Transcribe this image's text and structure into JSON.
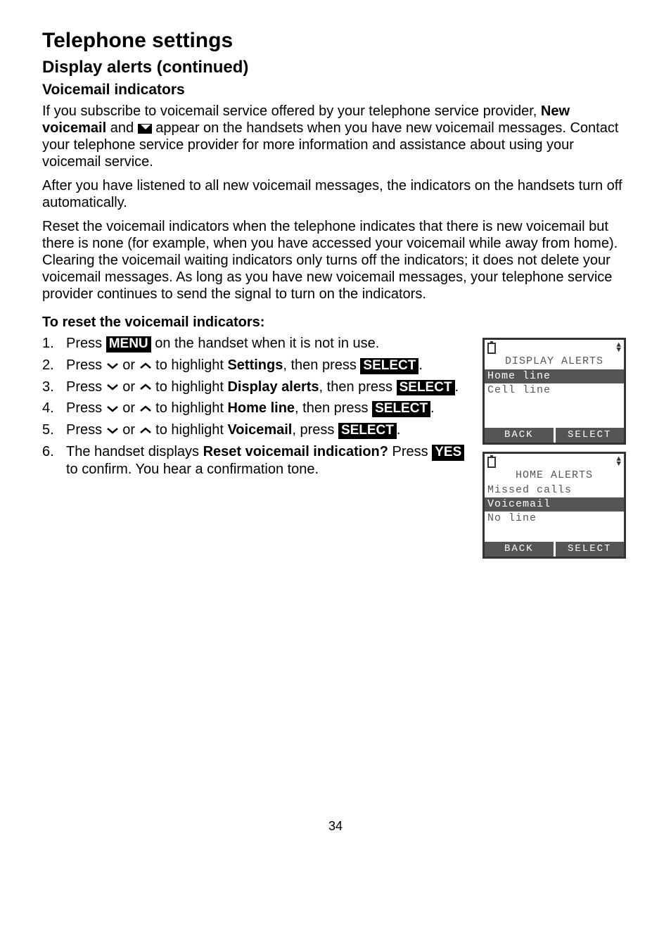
{
  "headings": {
    "h1": "Telephone settings",
    "h2": "Display alerts (continued)",
    "h3": "Voicemail indicators",
    "h4": "To reset the voicemail indicators:"
  },
  "paragraphs": {
    "p1a": "If you subscribe to voicemail service offered by your telephone service provider, ",
    "p1b": "New voicemail",
    "p1c": " and ",
    "p1d": " appear on the handsets when you have new voicemail messages. Contact your telephone service provider for more information and assistance about using your voicemail service.",
    "p2": "After you have listened to all new voicemail messages, the indicators on the handsets turn off automatically.",
    "p3": "Reset the voicemail indicators when the telephone indicates that there is new voicemail but there is none (for example, when you have accessed your voicemail while away from home). Clearing the voicemail waiting indicators only turns off the indicators; it does not delete your voicemail messages. As long as you have new voicemail messages, your telephone service provider continues to send the signal to turn on the indicators."
  },
  "steps": {
    "n1": "1.",
    "n2": "2.",
    "n3": "3.",
    "n4": "4.",
    "n5": "5.",
    "n6": "6.",
    "s1a": "Press ",
    "s1key": "MENU",
    "s1b": " on the handset when it is not in use.",
    "s2a": "Press ",
    "s2b": " or ",
    "s2c": " to highlight ",
    "s2bold": "Settings",
    "s2d": ", then press ",
    "s2key": "SELECT",
    "s2e": ".",
    "s3a": "Press ",
    "s3b": " or ",
    "s3c": " to highlight ",
    "s3bold": "Display alerts",
    "s3d": ", then press ",
    "s3key": "SELECT",
    "s3e": ".",
    "s4a": "Press ",
    "s4b": " or ",
    "s4c": " to highlight ",
    "s4bold": "Home line",
    "s4d": ", then press ",
    "s4key": "SELECT",
    "s4e": ".",
    "s5a": "Press ",
    "s5b": " or ",
    "s5c": " to highlight ",
    "s5bold": "Voicemail",
    "s5d": ", press ",
    "s5key": "SELECT",
    "s5e": ".",
    "s6a": "The handset displays ",
    "s6bold": "Reset voicemail indication?",
    "s6b": " Press ",
    "s6key": "YES",
    "s6c": " to confirm. You hear a confirmation tone."
  },
  "lcd1": {
    "title": "DISPLAY ALERTS",
    "row1": "Home line",
    "row2": "Cell line",
    "back": "BACK",
    "select": "SELECT"
  },
  "lcd2": {
    "title": "HOME ALERTS",
    "row1": "Missed calls",
    "row2": "Voicemail",
    "row3": "No line",
    "back": "BACK",
    "select": "SELECT"
  },
  "pagenum": "34"
}
